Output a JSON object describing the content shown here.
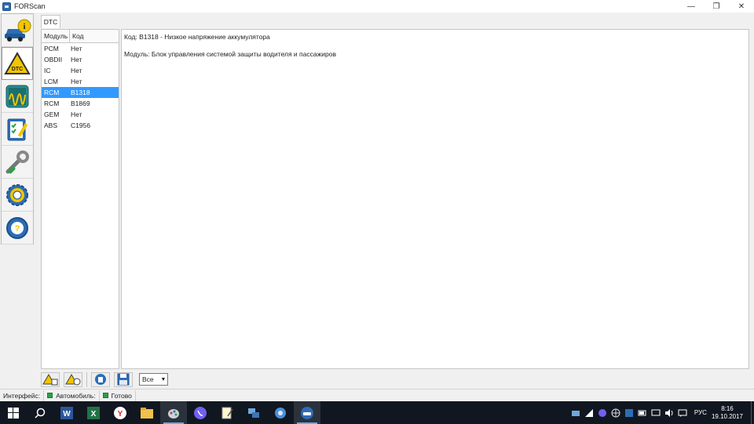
{
  "window": {
    "title": "FORScan",
    "controls": {
      "minimize": "—",
      "restore": "❐",
      "close": "✕"
    }
  },
  "sidebar": {
    "items": [
      {
        "name": "vehicle-info",
        "icon": "car-info-icon"
      },
      {
        "name": "dtc",
        "icon": "dtc-warning-icon",
        "active": true
      },
      {
        "name": "oscilloscope",
        "icon": "oscilloscope-icon"
      },
      {
        "name": "tests",
        "icon": "checklist-icon"
      },
      {
        "name": "service",
        "icon": "wrench-icon"
      },
      {
        "name": "settings",
        "icon": "gear-icon"
      },
      {
        "name": "help",
        "icon": "help-wheel-icon"
      }
    ]
  },
  "tabs": [
    {
      "label": "DTC"
    }
  ],
  "dtc_table": {
    "headers": {
      "module": "Модуль",
      "code": "Код"
    },
    "rows": [
      {
        "module": "PCM",
        "code": "Нет"
      },
      {
        "module": "OBDII",
        "code": "Нет"
      },
      {
        "module": "IC",
        "code": "Нет"
      },
      {
        "module": "LCM",
        "code": "Нет"
      },
      {
        "module": "RCM",
        "code": "B1318",
        "selected": true
      },
      {
        "module": "RCM",
        "code": "B1869"
      },
      {
        "module": "GEM",
        "code": "Нет"
      },
      {
        "module": "ABS",
        "code": "C1956"
      }
    ]
  },
  "detail": {
    "code_line": "Код: B1318 - Низкое напряжение аккумулятора",
    "module_line": "Модуль: Блок управления системой защиты водителя и пассажиров"
  },
  "bottom_toolbar": {
    "buttons": [
      "read-dtc-icon",
      "clear-dtc-icon",
      "delete-icon",
      "save-icon"
    ],
    "filter": {
      "selected": "Все"
    }
  },
  "statusbar": {
    "interface_label": "Интерфейс:",
    "vehicle_label": "Автомобиль:",
    "state_label": "Готово",
    "led_color": "#2aa147"
  },
  "taskbar": {
    "apps": [
      "windows-start-icon",
      "search-icon",
      "word-icon",
      "excel-icon",
      "yandex-browser-icon",
      "file-explorer-icon",
      "paint-icon",
      "viber-icon",
      "notepad-icon",
      "network-icon",
      "media-icon",
      "forscan-icon"
    ],
    "language": "РУС",
    "time": "8:16",
    "date": "19.10.2017"
  }
}
